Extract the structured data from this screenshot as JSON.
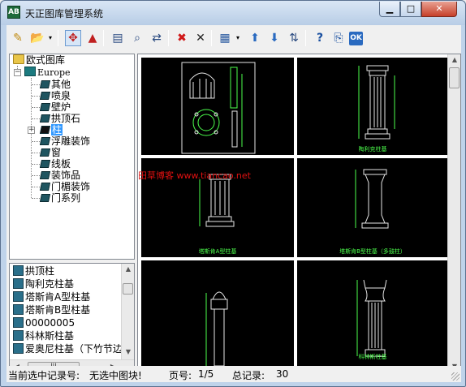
{
  "window": {
    "title": "天正图库管理系统",
    "app_icon_text": "AB",
    "min_glyph": "▁",
    "max_glyph": "□",
    "close_glyph": "✕"
  },
  "toolbar": {
    "buttons": [
      {
        "icon": "new-icon",
        "glyph": "✎"
      },
      {
        "icon": "open-folder-icon",
        "glyph": "📂"
      },
      {
        "icon": "fit-view-icon",
        "glyph": "✥"
      },
      {
        "icon": "tree-view-icon",
        "glyph": "▲"
      },
      {
        "icon": "save-icon",
        "glyph": "▤"
      },
      {
        "icon": "search-icon",
        "glyph": "⌕"
      },
      {
        "icon": "replace-icon",
        "glyph": "⇄"
      },
      {
        "icon": "delete-icon",
        "glyph": "✖"
      },
      {
        "icon": "delete-all-icon",
        "glyph": "✕"
      },
      {
        "icon": "grid-view-icon",
        "glyph": "▦"
      },
      {
        "icon": "move-up-icon",
        "glyph": "⬆"
      },
      {
        "icon": "move-down-icon",
        "glyph": "⬇"
      },
      {
        "icon": "sort-icon",
        "glyph": "⇅"
      },
      {
        "icon": "help-icon",
        "glyph": "?"
      },
      {
        "icon": "export-icon",
        "glyph": "⎘"
      },
      {
        "icon": "ok-icon",
        "glyph": "OK"
      }
    ],
    "dropdown_glyph": "▾"
  },
  "tree": {
    "root": "欧式图库",
    "group": "Europe",
    "items": [
      "其他",
      "喷泉",
      "壁炉",
      "拱顶石",
      "柱",
      "浮雕装饰",
      "窗",
      "线板",
      "装饰品",
      "门楣装饰",
      "门系列"
    ],
    "selected": "柱",
    "expander_glyph": "+",
    "collapse_glyph": "−"
  },
  "list": {
    "items": [
      "拱顶柱",
      "陶利克柱基",
      "塔斯肯A型柱基",
      "塔斯肯B型柱基",
      "00000005",
      "科林斯柱基",
      "爱奥尼柱基（下竹节边）"
    ],
    "up_arrow": "▲",
    "down_arrow": "▼",
    "left_arrow": "◀",
    "right_arrow": "▶",
    "thumb_grip": "|||"
  },
  "preview": {
    "captions": [
      "",
      "陶利克柱基",
      "塔斯肯A型柱基",
      "塔斯肯B型柱基（多鼓柱）",
      "",
      "科林斯柱基"
    ],
    "watermark": "田草博客 www.tiancao.net"
  },
  "status": {
    "record_label": "当前选中记录号:",
    "record_value": "无选中图块!",
    "page_label": "页号:",
    "page_value": "1/5",
    "total_label": "总记录:",
    "total_value": "30"
  }
}
